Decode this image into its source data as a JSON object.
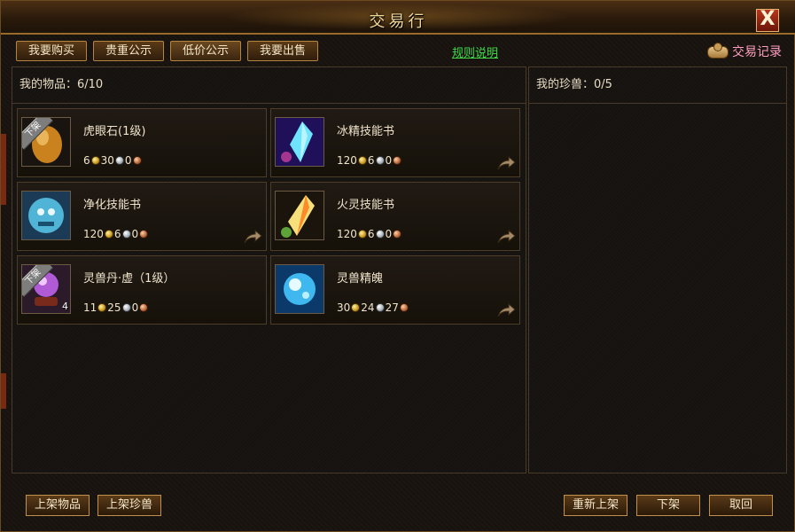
{
  "window": {
    "title": "交易行",
    "close_label": "X"
  },
  "tabs": [
    "我要购买",
    "贵重公示",
    "低价公示",
    "我要出售"
  ],
  "rules_link": "规则说明",
  "record_label": "交易记录",
  "left_panel": {
    "label": "我的物品：6/10"
  },
  "right_panel": {
    "label": "我的珍兽：0/5"
  },
  "items": [
    {
      "name": "虎眼石(1级)",
      "gold": "6",
      "silver": "30",
      "copper": "0",
      "tag": "下架",
      "stack": "",
      "share": false,
      "icon": "tiger-eye-stone-icon"
    },
    {
      "name": "冰精技能书",
      "gold": "120",
      "silver": "6",
      "copper": "0",
      "tag": "",
      "stack": "",
      "share": true,
      "icon": "ice-crystal-book-icon"
    },
    {
      "name": "净化技能书",
      "gold": "120",
      "silver": "6",
      "copper": "0",
      "tag": "",
      "stack": "",
      "share": true,
      "icon": "purify-book-icon"
    },
    {
      "name": "火灵技能书",
      "gold": "120",
      "silver": "6",
      "copper": "0",
      "tag": "",
      "stack": "",
      "share": true,
      "icon": "fire-spirit-book-icon"
    },
    {
      "name": "灵兽丹·虚（1级）",
      "gold": "11",
      "silver": "25",
      "copper": "0",
      "tag": "下架",
      "stack": "4",
      "share": false,
      "icon": "spirit-pill-icon"
    },
    {
      "name": "灵兽精魄",
      "gold": "30",
      "silver": "24",
      "copper": "27",
      "tag": "",
      "stack": "",
      "share": true,
      "icon": "spirit-soul-icon"
    }
  ],
  "buttons": {
    "list_item": "上架物品",
    "list_pet": "上架珍兽",
    "relist": "重新上架",
    "delist": "下架",
    "cancel": "取回"
  },
  "colors": {
    "rules_link": "#3fdc4a",
    "record_label": "#ff9ec2",
    "title": "#f2d79a"
  }
}
